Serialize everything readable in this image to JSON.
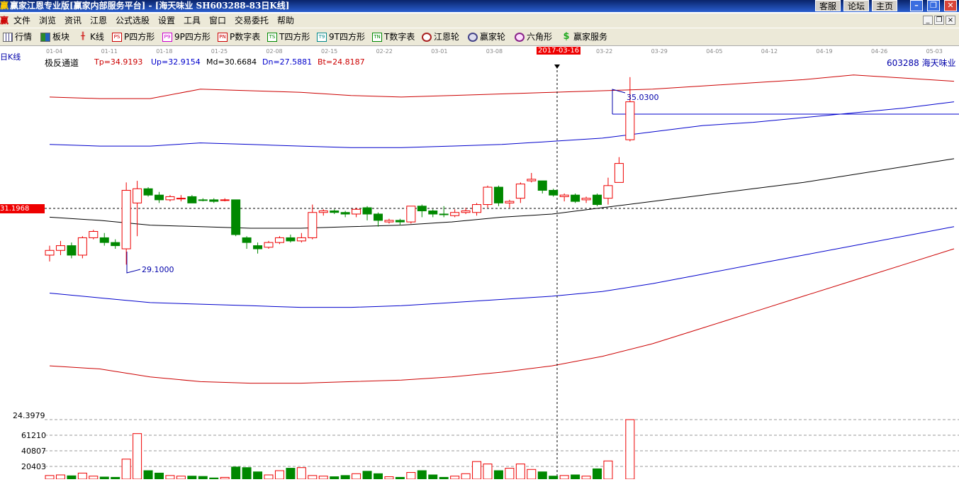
{
  "titlebar": {
    "app_icon": "赢",
    "title": "赢家江恩专业版[赢家内部服务平台] - [海天味业   SH603288-83日K线]",
    "buttons": [
      "客服",
      "论坛",
      "主页"
    ]
  },
  "menu": [
    "文件",
    "浏览",
    "资讯",
    "江恩",
    "公式选股",
    "设置",
    "工具",
    "窗口",
    "交易委托",
    "帮助"
  ],
  "menu_logo": "赢",
  "toolbar": [
    {
      "label": "行情",
      "icon": "grid-icon"
    },
    {
      "label": "板块",
      "icon": "blocks-icon"
    },
    {
      "label": "K线",
      "icon": "kline-icon"
    },
    {
      "label": "P四方形",
      "icon": "PS-icon",
      "tag": "PS"
    },
    {
      "label": "9P四方形",
      "icon": "P9-icon",
      "tag": "P9"
    },
    {
      "label": "P数字表",
      "icon": "PN-icon",
      "tag": "PN"
    },
    {
      "label": "T四方形",
      "icon": "TS-icon",
      "tag": "TS"
    },
    {
      "label": "9T四方形",
      "icon": "T9-icon",
      "tag": "T9"
    },
    {
      "label": "T数字表",
      "icon": "TN-icon",
      "tag": "TN"
    },
    {
      "label": "江恩轮",
      "icon": "wheel-icon"
    },
    {
      "label": "赢家轮",
      "icon": "big-wheel-icon"
    },
    {
      "label": "六角形",
      "icon": "hexagon-icon"
    },
    {
      "label": "赢家服务",
      "icon": "dollar-icon"
    }
  ],
  "chart_header": {
    "period_label": "日K线",
    "indicator": "极反通道",
    "tp": "Tp=34.9193",
    "up": "Up=32.9154",
    "md": "Md=30.6684",
    "dn": "Dn=27.5881",
    "bt": "Bt=24.8187",
    "stock": "603288  海天味业",
    "cursor_date": "2017-03-16",
    "cursor_price": "31.1968",
    "high_label": "35.0300",
    "low_label": "29.1000",
    "vol_top": "24.3979",
    "vol_ticks": [
      "61210",
      "40807",
      "20403"
    ]
  },
  "chart_data": {
    "type": "candlestick",
    "x_dates": [
      "01-04",
      "01-11",
      "01-18",
      "01-25",
      "02-08",
      "02-15",
      "02-22",
      "03-01",
      "03-08",
      "2017-03-16",
      "03-22",
      "03-29",
      "04-05",
      "04-12",
      "04-19",
      "04-26",
      "05-03"
    ],
    "candles": [
      {
        "o": 29.4,
        "c": 29.55,
        "h": 29.7,
        "l": 29.2,
        "up": true
      },
      {
        "o": 29.55,
        "c": 29.7,
        "h": 29.85,
        "l": 29.4,
        "up": true
      },
      {
        "o": 29.7,
        "c": 29.4,
        "h": 29.8,
        "l": 29.3,
        "up": false
      },
      {
        "o": 29.4,
        "c": 29.95,
        "h": 30.0,
        "l": 29.3,
        "up": true
      },
      {
        "o": 29.95,
        "c": 30.15,
        "h": 30.2,
        "l": 29.9,
        "up": true
      },
      {
        "o": 29.95,
        "c": 29.8,
        "h": 30.1,
        "l": 29.7,
        "up": false
      },
      {
        "o": 29.8,
        "c": 29.7,
        "h": 29.9,
        "l": 29.6,
        "up": false
      },
      {
        "o": 29.6,
        "c": 31.45,
        "h": 31.7,
        "l": 29.1,
        "up": true
      },
      {
        "o": 31.05,
        "c": 31.5,
        "h": 31.75,
        "l": 30.0,
        "up": true
      },
      {
        "o": 31.5,
        "c": 31.3,
        "h": 31.55,
        "l": 31.25,
        "up": false
      },
      {
        "o": 31.3,
        "c": 31.15,
        "h": 31.4,
        "l": 31.05,
        "up": false
      },
      {
        "o": 31.15,
        "c": 31.25,
        "h": 31.3,
        "l": 31.1,
        "up": true
      },
      {
        "o": 31.2,
        "c": 31.2,
        "h": 31.3,
        "l": 31.1,
        "up": true
      },
      {
        "o": 31.25,
        "c": 31.05,
        "h": 31.3,
        "l": 31.05,
        "up": false
      },
      {
        "o": 31.15,
        "c": 31.15,
        "h": 31.2,
        "l": 31.1,
        "up": false
      },
      {
        "o": 31.15,
        "c": 31.1,
        "h": 31.2,
        "l": 31.05,
        "up": false
      },
      {
        "o": 31.15,
        "c": 31.15,
        "h": 31.2,
        "l": 31.1,
        "up": true
      },
      {
        "o": 31.15,
        "c": 30.05,
        "h": 31.15,
        "l": 30.0,
        "up": false
      },
      {
        "o": 29.95,
        "c": 29.8,
        "h": 30.0,
        "l": 29.6,
        "up": false
      },
      {
        "o": 29.7,
        "c": 29.6,
        "h": 29.8,
        "l": 29.45,
        "up": false
      },
      {
        "o": 29.65,
        "c": 29.8,
        "h": 29.85,
        "l": 29.6,
        "up": true
      },
      {
        "o": 29.8,
        "c": 29.95,
        "h": 30.0,
        "l": 29.75,
        "up": true
      },
      {
        "o": 29.95,
        "c": 29.85,
        "h": 30.05,
        "l": 29.8,
        "up": false
      },
      {
        "o": 29.85,
        "c": 29.95,
        "h": 30.1,
        "l": 29.8,
        "up": true
      },
      {
        "o": 29.95,
        "c": 30.75,
        "h": 31.0,
        "l": 29.9,
        "up": true
      },
      {
        "o": 30.75,
        "c": 30.8,
        "h": 30.85,
        "l": 30.65,
        "up": true
      },
      {
        "o": 30.8,
        "c": 30.75,
        "h": 30.85,
        "l": 30.7,
        "up": false
      },
      {
        "o": 30.75,
        "c": 30.7,
        "h": 30.8,
        "l": 30.6,
        "up": false
      },
      {
        "o": 30.7,
        "c": 30.85,
        "h": 30.9,
        "l": 30.6,
        "up": true
      },
      {
        "o": 30.9,
        "c": 30.7,
        "h": 30.95,
        "l": 30.5,
        "up": false
      },
      {
        "o": 30.7,
        "c": 30.5,
        "h": 30.75,
        "l": 30.3,
        "up": false
      },
      {
        "o": 30.45,
        "c": 30.5,
        "h": 30.55,
        "l": 30.4,
        "up": true
      },
      {
        "o": 30.5,
        "c": 30.45,
        "h": 30.55,
        "l": 30.35,
        "up": false
      },
      {
        "o": 30.45,
        "c": 30.95,
        "h": 30.95,
        "l": 30.4,
        "up": true
      },
      {
        "o": 30.95,
        "c": 30.8,
        "h": 31.0,
        "l": 30.6,
        "up": false
      },
      {
        "o": 30.8,
        "c": 30.7,
        "h": 30.85,
        "l": 30.6,
        "up": false
      },
      {
        "o": 30.7,
        "c": 30.68,
        "h": 30.95,
        "l": 30.6,
        "up": false
      },
      {
        "o": 30.65,
        "c": 30.75,
        "h": 30.85,
        "l": 30.6,
        "up": true
      },
      {
        "o": 30.75,
        "c": 30.8,
        "h": 30.9,
        "l": 30.7,
        "up": true
      },
      {
        "o": 30.75,
        "c": 31.0,
        "h": 31.05,
        "l": 30.65,
        "up": true
      },
      {
        "o": 31.0,
        "c": 31.55,
        "h": 31.6,
        "l": 30.9,
        "up": true
      },
      {
        "o": 31.55,
        "c": 31.05,
        "h": 31.6,
        "l": 30.95,
        "up": false
      },
      {
        "o": 31.05,
        "c": 31.1,
        "h": 31.15,
        "l": 30.9,
        "up": true
      },
      {
        "o": 31.2,
        "c": 31.65,
        "h": 31.7,
        "l": 31.05,
        "up": true
      },
      {
        "o": 31.75,
        "c": 31.8,
        "h": 32.0,
        "l": 31.7,
        "up": true
      },
      {
        "o": 31.75,
        "c": 31.45,
        "h": 31.75,
        "l": 31.35,
        "up": false
      },
      {
        "o": 31.45,
        "c": 31.3,
        "h": 31.5,
        "l": 31.25,
        "up": false
      },
      {
        "o": 31.25,
        "c": 31.3,
        "h": 31.35,
        "l": 31.1,
        "up": true
      },
      {
        "o": 31.3,
        "c": 31.1,
        "h": 31.35,
        "l": 31.05,
        "up": false
      },
      {
        "o": 31.15,
        "c": 31.2,
        "h": 31.25,
        "l": 31.05,
        "up": true
      },
      {
        "o": 31.3,
        "c": 31.0,
        "h": 31.35,
        "l": 30.95,
        "up": false
      },
      {
        "o": 31.2,
        "c": 31.6,
        "h": 31.85,
        "l": 31.0,
        "up": true
      },
      {
        "o": 31.7,
        "c": 32.3,
        "h": 32.5,
        "l": 31.7,
        "up": true
      },
      {
        "o": 33.05,
        "c": 34.25,
        "h": 35.03,
        "l": 33.0,
        "up": true
      }
    ],
    "volumes": [
      6000,
      7000,
      5500,
      10000,
      5000,
      3500,
      3000,
      33000,
      75000,
      14000,
      10000,
      6000,
      5000,
      5000,
      4500,
      2000,
      3000,
      20000,
      19000,
      12000,
      7000,
      14000,
      18000,
      19000,
      6000,
      5000,
      4000,
      6000,
      9000,
      13000,
      9000,
      4000,
      3000,
      11000,
      14000,
      7000,
      3000,
      5000,
      9000,
      29000,
      25000,
      14000,
      18000,
      25000,
      16000,
      12000,
      5000,
      6000,
      7000,
      5000,
      17000,
      30000,
      0,
      98000
    ],
    "channel": {
      "tp": [
        34.4,
        34.35,
        34.35,
        34.65,
        34.6,
        34.55,
        34.45,
        34.4,
        34.45,
        34.5,
        34.55,
        34.6,
        34.65,
        34.75,
        34.85,
        34.95,
        35.1,
        35.0,
        34.9
      ],
      "up": [
        32.9,
        32.85,
        32.85,
        32.95,
        32.9,
        32.85,
        32.8,
        32.8,
        32.85,
        32.9,
        33.0,
        33.1,
        33.3,
        33.5,
        33.6,
        33.75,
        33.9,
        34.05,
        34.25
      ],
      "md": [
        30.6,
        30.5,
        30.35,
        30.3,
        30.25,
        30.25,
        30.3,
        30.35,
        30.45,
        30.6,
        30.7,
        30.9,
        31.1,
        31.3,
        31.5,
        31.7,
        31.95,
        32.2,
        32.45
      ],
      "dn": [
        28.2,
        28.05,
        27.9,
        27.85,
        27.8,
        27.75,
        27.75,
        27.8,
        27.9,
        28.0,
        28.1,
        28.25,
        28.5,
        28.8,
        29.1,
        29.4,
        29.7,
        30.0,
        30.3
      ],
      "bt": [
        25.9,
        25.8,
        25.55,
        25.4,
        25.35,
        25.35,
        25.4,
        25.45,
        25.55,
        25.7,
        25.9,
        26.2,
        26.6,
        27.1,
        27.6,
        28.1,
        28.6,
        29.1,
        29.6
      ]
    }
  }
}
